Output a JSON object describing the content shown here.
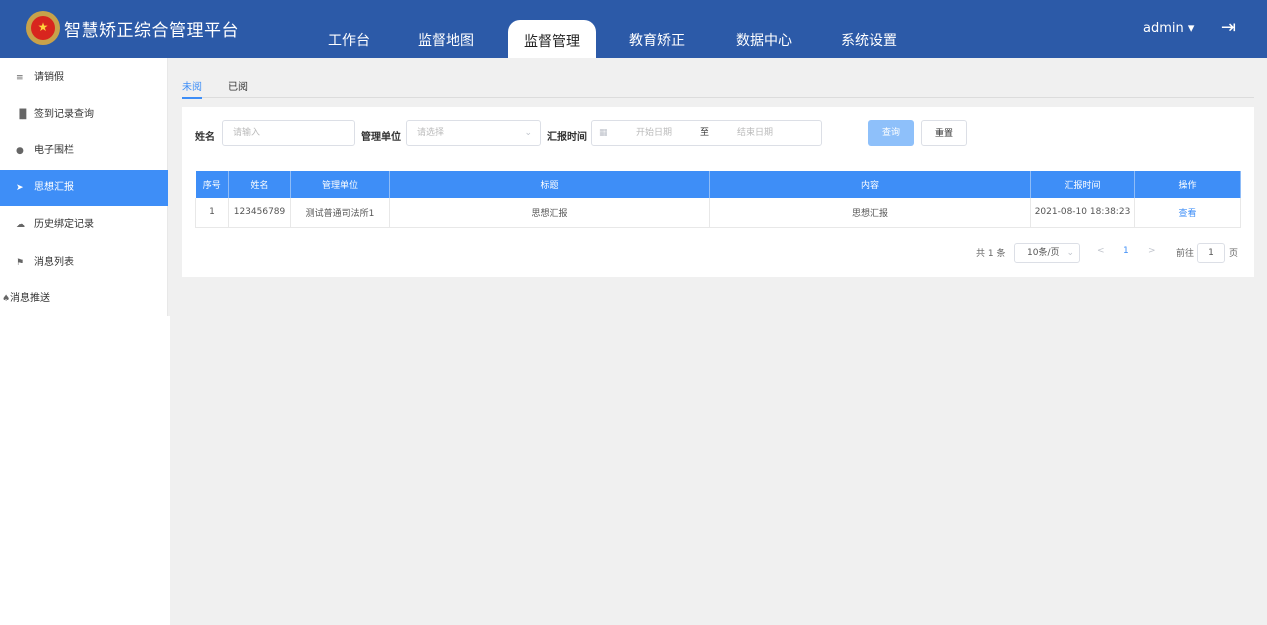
{
  "header": {
    "title": "智慧矫正综合管理平台",
    "nav": [
      "工作台",
      "监督地图",
      "监督管理",
      "教育矫正",
      "数据中心",
      "系统设置"
    ],
    "active_nav": "监督管理",
    "user": "admin",
    "user_caret": "▾",
    "logout_icon": "⇥"
  },
  "sidebar": {
    "items": [
      {
        "icon": "≡",
        "label": "请销假"
      },
      {
        "icon": "▐▌",
        "label": "签到记录查询"
      },
      {
        "icon": "●",
        "label": "电子围栏"
      },
      {
        "icon": "➤",
        "label": "思想汇报"
      },
      {
        "icon": "☁",
        "label": "历史绑定记录"
      },
      {
        "icon": "⚑",
        "label": "消息列表"
      },
      {
        "icon": "♠",
        "label": "消息推送"
      }
    ],
    "active_index": 3
  },
  "tabs": [
    "未阅",
    "已阅"
  ],
  "filters": {
    "name_label": "姓名",
    "name_placeholder": "请输入",
    "unit_label": "管理单位",
    "unit_placeholder": "请选择",
    "time_label": "汇报时间",
    "start_placeholder": "开始日期",
    "separator": "至",
    "end_placeholder": "结束日期",
    "calendar_icon": "▦",
    "select_caret": "⌄"
  },
  "buttons": {
    "query": "查询",
    "reset": "重置"
  },
  "table": {
    "headers": [
      "序号",
      "姓名",
      "管理单位",
      "标题",
      "内容",
      "汇报时间",
      "操作"
    ],
    "rows": [
      {
        "index": "1",
        "name": "123456789",
        "unit": "测试普通司法所1",
        "title": "思想汇报",
        "content": "思想汇报",
        "time": "2021-08-10 18:38:23",
        "action": "查看"
      }
    ]
  },
  "pagination": {
    "total": "共 1 条",
    "page_size": "10条/页",
    "prev": "<",
    "current_page": "1",
    "next": ">",
    "goto_label": "前往",
    "goto_value": "1",
    "page_suffix": "页"
  },
  "colors": {
    "header": "#2c5aa8",
    "accent": "#3e8ef7"
  }
}
